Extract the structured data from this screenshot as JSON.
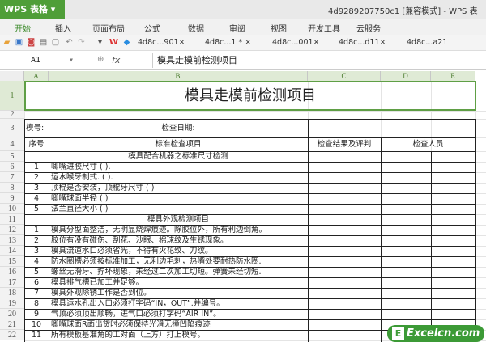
{
  "app": {
    "logo": "WPS 表格",
    "title": "4d9289207750c1 [兼容模式] - WPS 表"
  },
  "menu": [
    "开始",
    "插入",
    "页面布局",
    "公式",
    "数据",
    "审阅",
    "视图",
    "开发工具",
    "云服务"
  ],
  "doc_tabs": [
    "4d8c...901×",
    "4d8c...1 * ×",
    "4d8c...001×",
    "4d8c...d11×",
    "4d8c...a21"
  ],
  "formula": {
    "cell_ref": "A1",
    "fx": "fx",
    "value": "模具走模前检测项目"
  },
  "columns": [
    "A",
    "B",
    "C",
    "D",
    "E"
  ],
  "rows": [
    "1",
    "2",
    "3",
    "4",
    "5",
    "6",
    "7",
    "8",
    "9",
    "10",
    "11",
    "12",
    "13",
    "14",
    "15",
    "16",
    "17",
    "18",
    "19",
    "20",
    "21",
    "22"
  ],
  "sheet": {
    "title": "模具走模前检测项目",
    "mold_no": "模号:",
    "check_date": "检查日期:",
    "hdr_no": "序号",
    "hdr_item": "标准检查项目",
    "hdr_result": "检查结果及评判",
    "hdr_person": "检查人员",
    "section1": "模具配合机器之标准尺寸检测",
    "items1": [
      {
        "n": "1",
        "t": "唧嘴进胶尺寸          (          )."
      },
      {
        "n": "2",
        "t": "运水喉牙制式.        (          )."
      },
      {
        "n": "3",
        "t": "顶棍是否安装，顶棍牙尺寸    (          )"
      },
      {
        "n": "4",
        "t": "唧嘴球面半径    (          )"
      },
      {
        "n": "5",
        "t": "法兰直径大小    (          )"
      }
    ],
    "section2": "模具外观检测项目",
    "items2": [
      {
        "n": "1",
        "t": "模具分型面整洁，无明显烧焊痕迹。除胶位外，所有利边倒角。"
      },
      {
        "n": "2",
        "t": "胶位有没有碰伤、刮花、沙眼、棉球纹及生锈现象。"
      },
      {
        "n": "3",
        "t": "模具流道水口必须省光，不得有火花纹、刀纹。"
      },
      {
        "n": "4",
        "t": "防水圈槽必须按标准加工，无利边毛刺，热嘴处要耐热防水圈."
      },
      {
        "n": "5",
        "t": "螺丝无滑牙、拧坏现象，未经过二次加工切短。弹簧未经切短."
      },
      {
        "n": "6",
        "t": "模具排气槽已加工并足够。"
      },
      {
        "n": "7",
        "t": "模具外观除锈工作是否到位。"
      },
      {
        "n": "8",
        "t": "模具运水孔出入口必须打字码“IN，OUT”.并编号。"
      },
      {
        "n": "9",
        "t": "气顶必须顶出顺畅，进气口必须打字码“AIR   IN”。"
      },
      {
        "n": "10",
        "t": "唧嘴球面R面出货时必须保持光滑无撞凹陷痕迹"
      },
      {
        "n": "11",
        "t": "所有模板基准角的工对面（上方）打上模号。"
      }
    ]
  },
  "watermark": "Excelcn.com",
  "colors": {
    "accent": "#4f9e38",
    "header_bg": "#dfead5"
  }
}
